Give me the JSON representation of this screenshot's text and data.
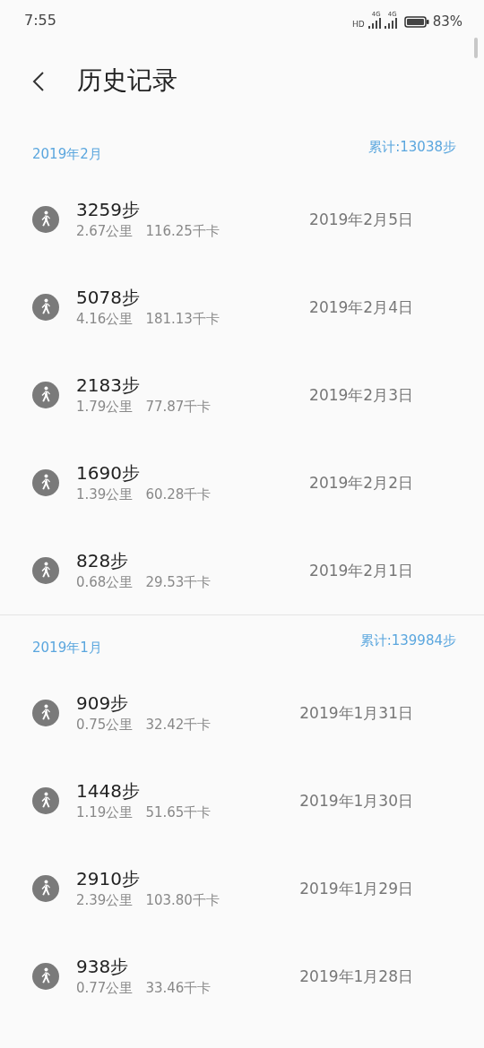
{
  "status_bar": {
    "time": "7:55",
    "hd": "HD",
    "network_1": "4G",
    "network_2": "4G",
    "battery": "83%"
  },
  "header": {
    "title": "历史记录"
  },
  "sections": [
    {
      "month": "2019年2月",
      "total": "累计:13038步",
      "records": [
        {
          "steps": "3259步",
          "distance": "2.67公里",
          "calories": "116.25千卡",
          "date": "2019年2月5日"
        },
        {
          "steps": "5078步",
          "distance": "4.16公里",
          "calories": "181.13千卡",
          "date": "2019年2月4日"
        },
        {
          "steps": "2183步",
          "distance": "1.79公里",
          "calories": "77.87千卡",
          "date": "2019年2月3日"
        },
        {
          "steps": "1690步",
          "distance": "1.39公里",
          "calories": "60.28千卡",
          "date": "2019年2月2日"
        },
        {
          "steps": "828步",
          "distance": "0.68公里",
          "calories": "29.53千卡",
          "date": "2019年2月1日"
        }
      ]
    },
    {
      "month": "2019年1月",
      "total": "累计:139984步",
      "records": [
        {
          "steps": "909步",
          "distance": "0.75公里",
          "calories": "32.42千卡",
          "date": "2019年1月31日"
        },
        {
          "steps": "1448步",
          "distance": "1.19公里",
          "calories": "51.65千卡",
          "date": "2019年1月30日"
        },
        {
          "steps": "2910步",
          "distance": "2.39公里",
          "calories": "103.80千卡",
          "date": "2019年1月29日"
        },
        {
          "steps": "938步",
          "distance": "0.77公里",
          "calories": "33.46千卡",
          "date": "2019年1月28日"
        }
      ]
    }
  ]
}
